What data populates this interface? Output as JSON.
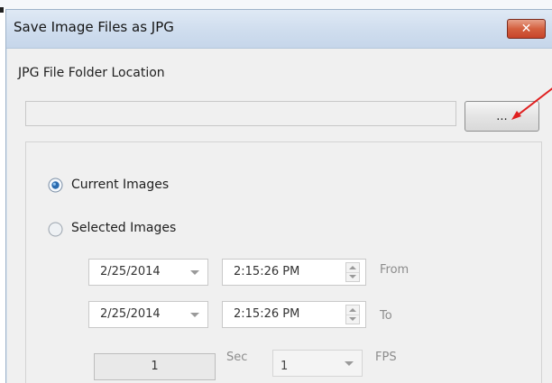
{
  "window": {
    "title": "Save Image Files as JPG",
    "close_glyph": "✕"
  },
  "folder": {
    "label": "JPG File Folder Location",
    "path_value": "",
    "browse_label": "..."
  },
  "selection": {
    "current_images_label": "Current Images",
    "current_images_selected": true,
    "selected_images_label": "Selected Images",
    "selected_images_selected": false
  },
  "range": {
    "from": {
      "date": "2/25/2014",
      "time": "2:15:26 PM",
      "label": "From"
    },
    "to": {
      "date": "2/25/2014",
      "time": "2:15:26 PM",
      "label": "To"
    }
  },
  "timing": {
    "sec_value": "1",
    "sec_label": "Sec",
    "fps_value": "1",
    "fps_label": "FPS"
  },
  "colors": {
    "accent_radio": "#2b6cb0",
    "close_button": "#c7442a",
    "arrow": "#e02020"
  },
  "icons": {
    "close": "close-icon",
    "dropdown": "chevron-down-icon",
    "spinner": "spin-buttons-icon"
  }
}
